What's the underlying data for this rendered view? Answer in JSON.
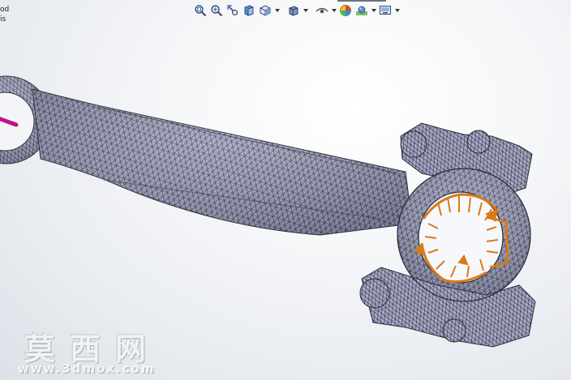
{
  "feature_tree": {
    "line1": "od",
    "line2": "is"
  },
  "heads_up_toolbar": {
    "tools": [
      {
        "name": "zoom-to-fit-icon"
      },
      {
        "name": "zoom-to-area-icon"
      },
      {
        "name": "previous-view-icon"
      },
      {
        "name": "section-view-icon"
      },
      {
        "name": "view-orientation-icon",
        "dropdown": true
      },
      {
        "name": "display-style-icon",
        "dropdown": true
      },
      {
        "name": "hide-show-items-icon",
        "dropdown": true
      },
      {
        "name": "edit-appearance-icon"
      },
      {
        "name": "apply-scene-icon",
        "dropdown": true
      },
      {
        "name": "view-settings-icon",
        "dropdown": true
      }
    ]
  },
  "model": {
    "part": "connecting rod",
    "mesh_color": "#a4a7c4",
    "mesh_line_color": "#2a2c3a",
    "fixture_color": "#c0128c",
    "load_arrow_color": "#d97a1a"
  },
  "watermark": {
    "text": "莫西网",
    "url": "www.3dmox.com"
  }
}
